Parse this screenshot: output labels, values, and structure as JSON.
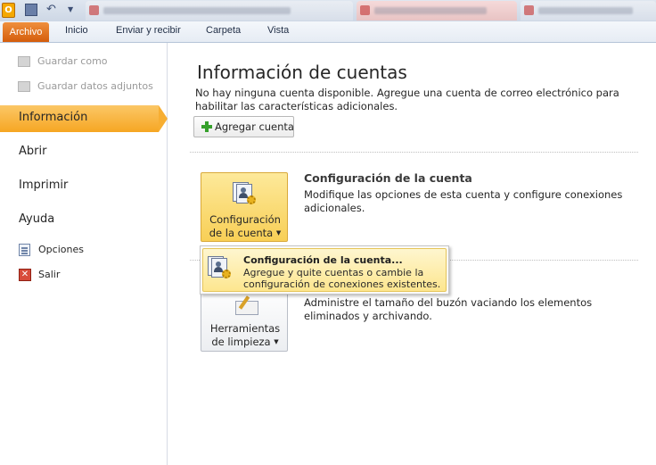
{
  "app": {
    "logo_letter": "O"
  },
  "ribbon": {
    "tabs": [
      {
        "label": "Archivo"
      },
      {
        "label": "Inicio"
      },
      {
        "label": "Enviar y recibir"
      },
      {
        "label": "Carpeta"
      },
      {
        "label": "Vista"
      }
    ]
  },
  "sidebar": {
    "commands_top": [
      {
        "label": "Guardar como"
      },
      {
        "label": "Guardar datos adjuntos"
      }
    ],
    "tabs": [
      {
        "label": "Información"
      },
      {
        "label": "Abrir"
      },
      {
        "label": "Imprimir"
      },
      {
        "label": "Ayuda"
      }
    ],
    "commands_bottom": [
      {
        "label": "Opciones"
      },
      {
        "label": "Salir"
      }
    ]
  },
  "main": {
    "title": "Información de cuentas",
    "no_account_text": "No hay ninguna cuenta disponible. Agregue una cuenta de correo electrónico para habilitar las características adicionales.",
    "add_account_label": "Agregar cuenta",
    "account_settings": {
      "button_label_line1": "Configuración",
      "button_label_line2": "de la cuenta",
      "title": "Configuración de la cuenta",
      "description": "Modifique las opciones de esta cuenta y configure conexiones adicionales."
    },
    "cleanup": {
      "button_label_line1": "Herramientas",
      "button_label_line2": "de limpieza",
      "description": "Administre el tamaño del buzón vaciando los elementos eliminados y archivando."
    }
  },
  "dropdown": {
    "item_title": "Configuración de la cuenta...",
    "item_description": "Agregue y quite cuentas o cambie la configuración de conexiones existentes."
  },
  "colors": {
    "archivo_tab": "#e06c1c",
    "selected_sidebar": "#f8b033",
    "dropdown_highlight": "#fde68f"
  }
}
